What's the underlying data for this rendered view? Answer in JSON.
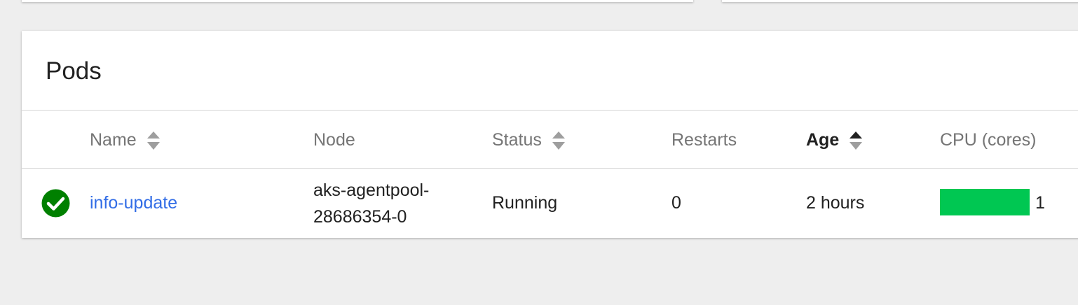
{
  "pods_card": {
    "title": "Pods",
    "columns": {
      "name": "Name",
      "node": "Node",
      "status": "Status",
      "restarts": "Restarts",
      "age": "Age",
      "cpu": "CPU (cores)"
    },
    "sort_icon": "sort-updown-icon",
    "active_sort_column": "Age",
    "rows": [
      {
        "status_icon": "check-circle-icon",
        "status_color": "#008000",
        "name": "info-update",
        "node_line1": "aks-agentpool-",
        "node_line2": "28686354-0",
        "status": "Running",
        "restarts": "0",
        "age": "2 hours",
        "cpu_value": "1",
        "cpu_bar_color": "#00c752"
      }
    ]
  },
  "colors": {
    "link": "#326de6",
    "background": "#eeeeee",
    "text": "#212121",
    "header_text": "#757575"
  }
}
